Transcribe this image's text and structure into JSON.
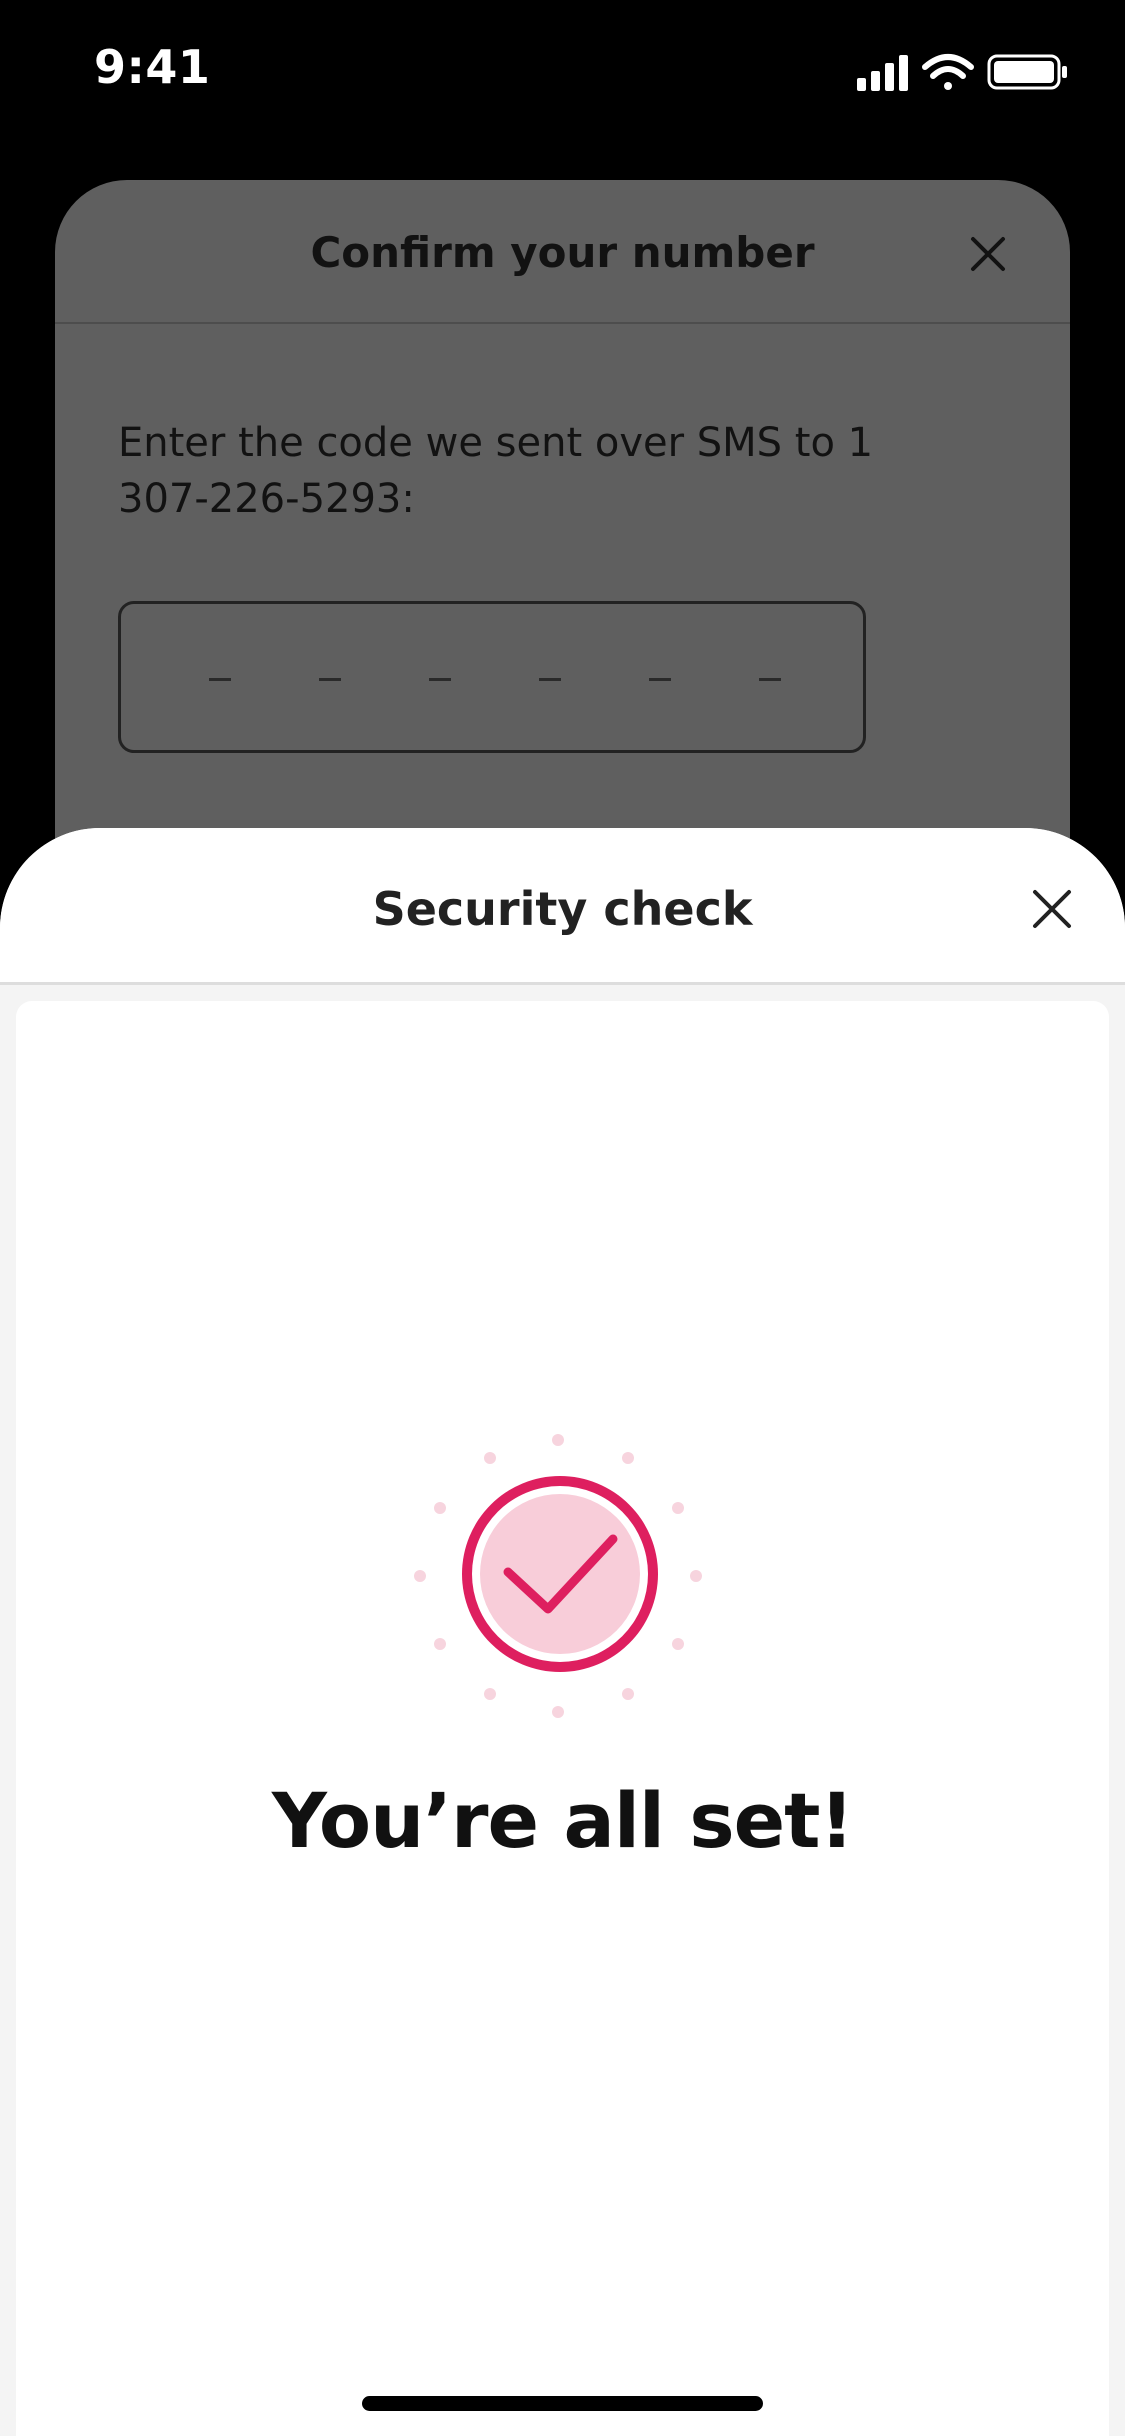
{
  "status_bar": {
    "time": "9:41",
    "icons": [
      "signal-icon",
      "wifi-icon",
      "battery-icon"
    ]
  },
  "background_modal": {
    "title": "Confirm your number",
    "message": "Enter the code we sent over SMS to 1 307-226-5293:",
    "code_placeholder_count": 6
  },
  "security_sheet": {
    "title": "Security check",
    "success_message": "You’re all set!"
  },
  "colors": {
    "accent": "#de1f5f",
    "accent_light": "#f8cdd9",
    "overlay": "#5f5f5f"
  }
}
